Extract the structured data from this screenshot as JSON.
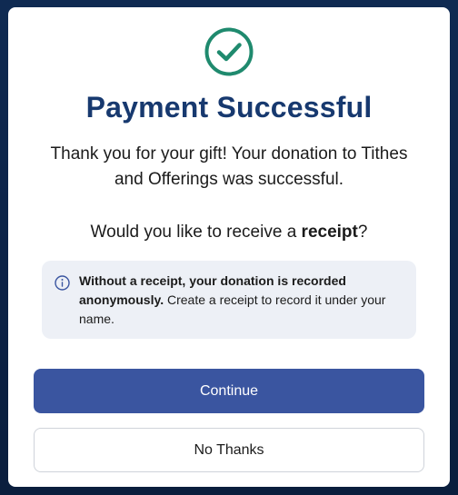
{
  "modal": {
    "icon": "check-circle-icon",
    "title": "Payment Successful",
    "message": "Thank you for your gift! Your donation to Tithes and Offerings was successful.",
    "question_prefix": "Would you like to receive a ",
    "question_bold": "receipt",
    "question_suffix": "?",
    "info": {
      "icon": "info-icon",
      "bold_text": "Without a receipt, your donation is recorded anonymously.",
      "text": " Create a receipt to record it under your name."
    },
    "continue_label": "Continue",
    "no_thanks_label": "No Thanks"
  },
  "colors": {
    "title": "#17396f",
    "success_green": "#1f8a6e",
    "primary_button": "#3a55a0",
    "info_background": "#edf0f6",
    "backdrop": "#0c2347"
  }
}
